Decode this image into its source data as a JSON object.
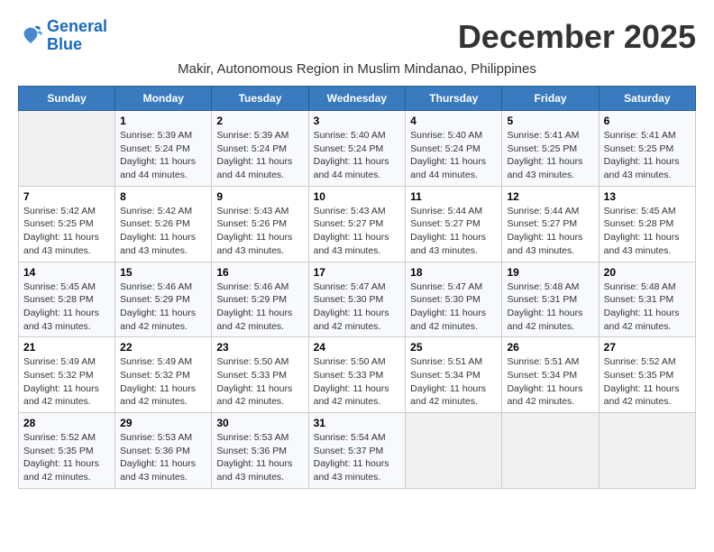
{
  "header": {
    "logo_line1": "General",
    "logo_line2": "Blue",
    "month_title": "December 2025",
    "subtitle": "Makir, Autonomous Region in Muslim Mindanao, Philippines"
  },
  "days_of_week": [
    "Sunday",
    "Monday",
    "Tuesday",
    "Wednesday",
    "Thursday",
    "Friday",
    "Saturday"
  ],
  "weeks": [
    [
      {
        "day": "",
        "sunrise": "",
        "sunset": "",
        "daylight": ""
      },
      {
        "day": "1",
        "sunrise": "Sunrise: 5:39 AM",
        "sunset": "Sunset: 5:24 PM",
        "daylight": "Daylight: 11 hours and 44 minutes."
      },
      {
        "day": "2",
        "sunrise": "Sunrise: 5:39 AM",
        "sunset": "Sunset: 5:24 PM",
        "daylight": "Daylight: 11 hours and 44 minutes."
      },
      {
        "day": "3",
        "sunrise": "Sunrise: 5:40 AM",
        "sunset": "Sunset: 5:24 PM",
        "daylight": "Daylight: 11 hours and 44 minutes."
      },
      {
        "day": "4",
        "sunrise": "Sunrise: 5:40 AM",
        "sunset": "Sunset: 5:24 PM",
        "daylight": "Daylight: 11 hours and 44 minutes."
      },
      {
        "day": "5",
        "sunrise": "Sunrise: 5:41 AM",
        "sunset": "Sunset: 5:25 PM",
        "daylight": "Daylight: 11 hours and 43 minutes."
      },
      {
        "day": "6",
        "sunrise": "Sunrise: 5:41 AM",
        "sunset": "Sunset: 5:25 PM",
        "daylight": "Daylight: 11 hours and 43 minutes."
      }
    ],
    [
      {
        "day": "7",
        "sunrise": "Sunrise: 5:42 AM",
        "sunset": "Sunset: 5:25 PM",
        "daylight": "Daylight: 11 hours and 43 minutes."
      },
      {
        "day": "8",
        "sunrise": "Sunrise: 5:42 AM",
        "sunset": "Sunset: 5:26 PM",
        "daylight": "Daylight: 11 hours and 43 minutes."
      },
      {
        "day": "9",
        "sunrise": "Sunrise: 5:43 AM",
        "sunset": "Sunset: 5:26 PM",
        "daylight": "Daylight: 11 hours and 43 minutes."
      },
      {
        "day": "10",
        "sunrise": "Sunrise: 5:43 AM",
        "sunset": "Sunset: 5:27 PM",
        "daylight": "Daylight: 11 hours and 43 minutes."
      },
      {
        "day": "11",
        "sunrise": "Sunrise: 5:44 AM",
        "sunset": "Sunset: 5:27 PM",
        "daylight": "Daylight: 11 hours and 43 minutes."
      },
      {
        "day": "12",
        "sunrise": "Sunrise: 5:44 AM",
        "sunset": "Sunset: 5:27 PM",
        "daylight": "Daylight: 11 hours and 43 minutes."
      },
      {
        "day": "13",
        "sunrise": "Sunrise: 5:45 AM",
        "sunset": "Sunset: 5:28 PM",
        "daylight": "Daylight: 11 hours and 43 minutes."
      }
    ],
    [
      {
        "day": "14",
        "sunrise": "Sunrise: 5:45 AM",
        "sunset": "Sunset: 5:28 PM",
        "daylight": "Daylight: 11 hours and 43 minutes."
      },
      {
        "day": "15",
        "sunrise": "Sunrise: 5:46 AM",
        "sunset": "Sunset: 5:29 PM",
        "daylight": "Daylight: 11 hours and 42 minutes."
      },
      {
        "day": "16",
        "sunrise": "Sunrise: 5:46 AM",
        "sunset": "Sunset: 5:29 PM",
        "daylight": "Daylight: 11 hours and 42 minutes."
      },
      {
        "day": "17",
        "sunrise": "Sunrise: 5:47 AM",
        "sunset": "Sunset: 5:30 PM",
        "daylight": "Daylight: 11 hours and 42 minutes."
      },
      {
        "day": "18",
        "sunrise": "Sunrise: 5:47 AM",
        "sunset": "Sunset: 5:30 PM",
        "daylight": "Daylight: 11 hours and 42 minutes."
      },
      {
        "day": "19",
        "sunrise": "Sunrise: 5:48 AM",
        "sunset": "Sunset: 5:31 PM",
        "daylight": "Daylight: 11 hours and 42 minutes."
      },
      {
        "day": "20",
        "sunrise": "Sunrise: 5:48 AM",
        "sunset": "Sunset: 5:31 PM",
        "daylight": "Daylight: 11 hours and 42 minutes."
      }
    ],
    [
      {
        "day": "21",
        "sunrise": "Sunrise: 5:49 AM",
        "sunset": "Sunset: 5:32 PM",
        "daylight": "Daylight: 11 hours and 42 minutes."
      },
      {
        "day": "22",
        "sunrise": "Sunrise: 5:49 AM",
        "sunset": "Sunset: 5:32 PM",
        "daylight": "Daylight: 11 hours and 42 minutes."
      },
      {
        "day": "23",
        "sunrise": "Sunrise: 5:50 AM",
        "sunset": "Sunset: 5:33 PM",
        "daylight": "Daylight: 11 hours and 42 minutes."
      },
      {
        "day": "24",
        "sunrise": "Sunrise: 5:50 AM",
        "sunset": "Sunset: 5:33 PM",
        "daylight": "Daylight: 11 hours and 42 minutes."
      },
      {
        "day": "25",
        "sunrise": "Sunrise: 5:51 AM",
        "sunset": "Sunset: 5:34 PM",
        "daylight": "Daylight: 11 hours and 42 minutes."
      },
      {
        "day": "26",
        "sunrise": "Sunrise: 5:51 AM",
        "sunset": "Sunset: 5:34 PM",
        "daylight": "Daylight: 11 hours and 42 minutes."
      },
      {
        "day": "27",
        "sunrise": "Sunrise: 5:52 AM",
        "sunset": "Sunset: 5:35 PM",
        "daylight": "Daylight: 11 hours and 42 minutes."
      }
    ],
    [
      {
        "day": "28",
        "sunrise": "Sunrise: 5:52 AM",
        "sunset": "Sunset: 5:35 PM",
        "daylight": "Daylight: 11 hours and 42 minutes."
      },
      {
        "day": "29",
        "sunrise": "Sunrise: 5:53 AM",
        "sunset": "Sunset: 5:36 PM",
        "daylight": "Daylight: 11 hours and 43 minutes."
      },
      {
        "day": "30",
        "sunrise": "Sunrise: 5:53 AM",
        "sunset": "Sunset: 5:36 PM",
        "daylight": "Daylight: 11 hours and 43 minutes."
      },
      {
        "day": "31",
        "sunrise": "Sunrise: 5:54 AM",
        "sunset": "Sunset: 5:37 PM",
        "daylight": "Daylight: 11 hours and 43 minutes."
      },
      {
        "day": "",
        "sunrise": "",
        "sunset": "",
        "daylight": ""
      },
      {
        "day": "",
        "sunrise": "",
        "sunset": "",
        "daylight": ""
      },
      {
        "day": "",
        "sunrise": "",
        "sunset": "",
        "daylight": ""
      }
    ]
  ]
}
